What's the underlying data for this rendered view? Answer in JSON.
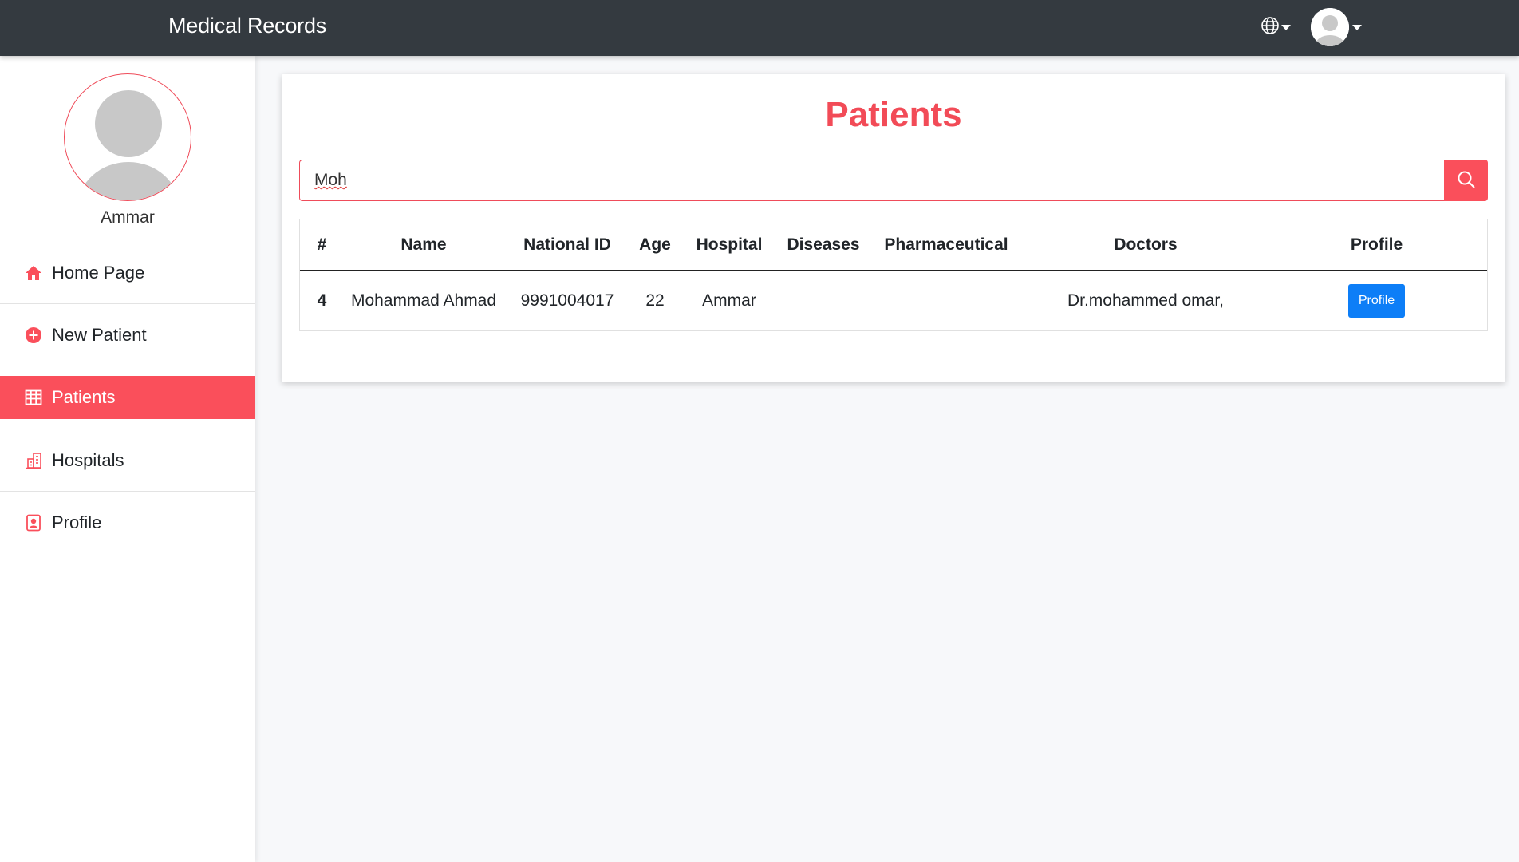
{
  "header": {
    "brand": "Medical Records",
    "language_icon": "globe-icon",
    "user_icon": "avatar-icon"
  },
  "sidebar": {
    "user_name": "Ammar",
    "items": [
      {
        "label": "Home Page",
        "icon": "home-icon"
      },
      {
        "label": "New Patient",
        "icon": "plus-circle-icon"
      },
      {
        "label": "Patients",
        "icon": "table-icon",
        "active": true
      },
      {
        "label": "Hospitals",
        "icon": "building-icon"
      },
      {
        "label": "Profile",
        "icon": "person-badge-icon"
      }
    ]
  },
  "main": {
    "title": "Patients",
    "search": {
      "value": "Moh",
      "button_icon": "search-icon"
    },
    "table": {
      "columns": [
        "#",
        "Name",
        "National ID",
        "Age",
        "Hospital",
        "Diseases",
        "Pharmaceutical",
        "Doctors",
        "Profile"
      ],
      "rows": [
        {
          "num": "4",
          "name": "Mohammad Ahmad",
          "national_id": "9991004017",
          "age": "22",
          "hospital": "Ammar",
          "diseases": "",
          "pharmaceutical": "",
          "doctors": "Dr.mohammed omar,",
          "profile_button": "Profile"
        }
      ]
    }
  },
  "colors": {
    "accent": "#fa4f5b",
    "topbar": "#343a40",
    "primary_button": "#0d7ef7"
  }
}
